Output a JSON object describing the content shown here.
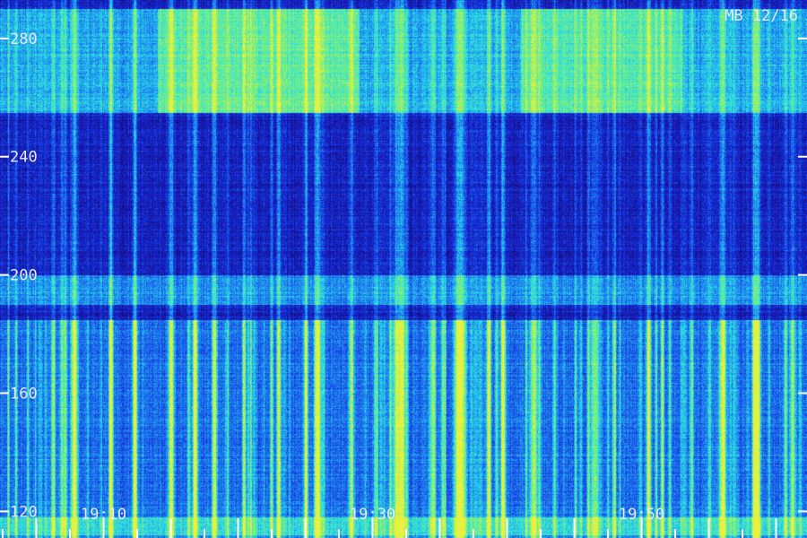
{
  "chart_data": {
    "type": "heatmap",
    "title": "",
    "annotation": "MB 12/16",
    "xlabel": "",
    "ylabel": "",
    "y_ticks": [
      120,
      160,
      200,
      240,
      280
    ],
    "y_tick_labels": [
      "120",
      "160",
      "200",
      "240",
      "280"
    ],
    "x_tick_labels": [
      {
        "label": "19:10",
        "t": 10
      },
      {
        "label": "19:30",
        "t": 30
      },
      {
        "label": "19:50",
        "t": 50
      }
    ],
    "x_minor_step_min": 2.5,
    "ylim": [
      111,
      293
    ],
    "xlim": [
      2.3,
      62.3
    ],
    "colormap": [
      "#000018",
      "#1a0a7a",
      "#1428d8",
      "#1e7cf0",
      "#28e0e8",
      "#7af07a",
      "#e8f040"
    ],
    "features": [
      {
        "name": "upper-band",
        "y_range": [
          255,
          290
        ],
        "intensity": 0.55,
        "clusters": [
          {
            "t_range": [
              14,
              29
            ],
            "intensity": 0.85
          },
          {
            "t_range": [
              41,
              53
            ],
            "intensity": 0.75
          }
        ]
      },
      {
        "name": "horizontal-band",
        "y_range": [
          190,
          200
        ],
        "intensity": 0.45
      },
      {
        "name": "lower-band",
        "y_range": [
          112,
          185
        ],
        "intensity": 0.35
      },
      {
        "name": "vertical-bursts",
        "y_range": [
          112,
          290
        ],
        "t_centers": [
          7.8,
          10.5,
          12.3,
          15.0,
          18.2,
          20.4,
          23.0,
          25.8,
          28.4,
          31.8,
          32.2,
          34.5,
          35.2,
          36.5,
          39.7,
          42.0,
          46.5,
          50.5,
          56.0,
          58.5,
          61.2
        ],
        "peak_intensity": 0.95
      }
    ]
  }
}
